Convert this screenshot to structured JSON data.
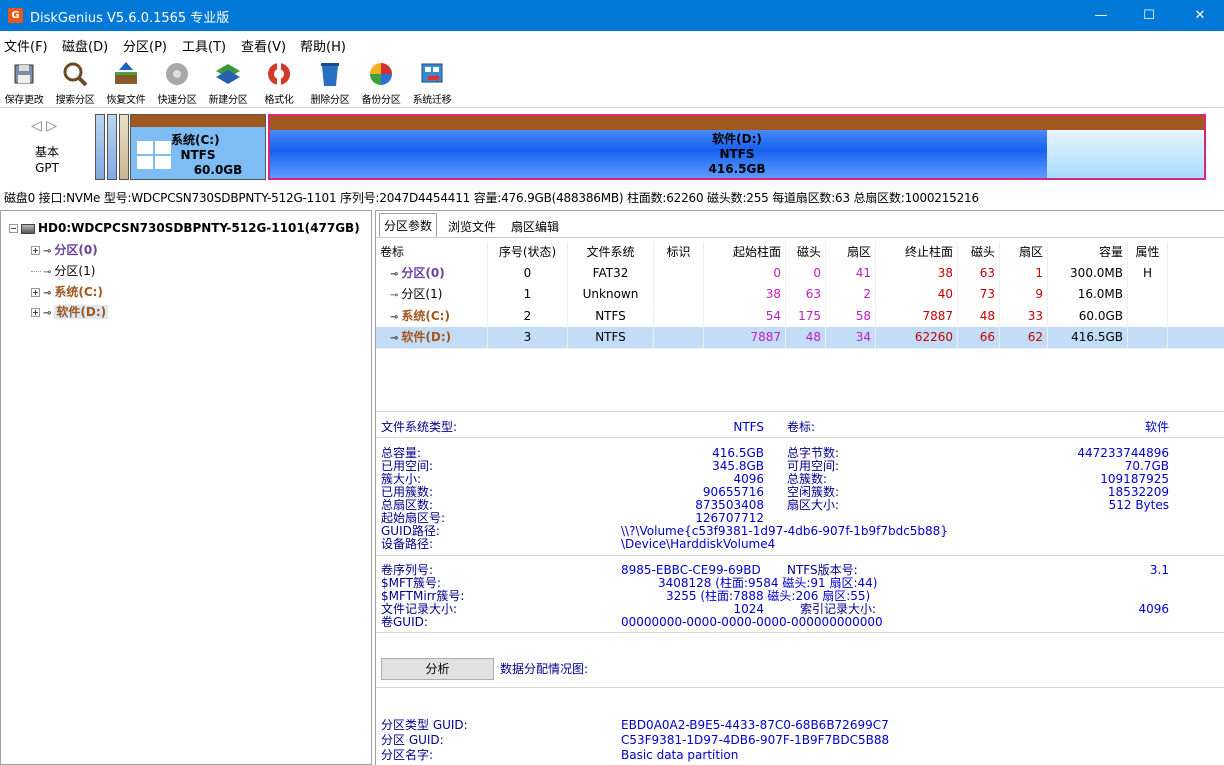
{
  "window": {
    "icon_letter": "G",
    "title": "DiskGenius V5.6.0.1565 专业版",
    "minimize": "—",
    "maximize": "☐",
    "close": "✕"
  },
  "menu": [
    "文件(F)",
    "磁盘(D)",
    "分区(P)",
    "工具(T)",
    "查看(V)",
    "帮助(H)"
  ],
  "toolbar": [
    {
      "label": "保存更改",
      "icon": "save-icon"
    },
    {
      "label": "搜索分区",
      "icon": "search-icon"
    },
    {
      "label": "恢复文件",
      "icon": "recover-icon"
    },
    {
      "label": "快速分区",
      "icon": "quick-partition-icon"
    },
    {
      "label": "新建分区",
      "icon": "new-partition-icon"
    },
    {
      "label": "格式化",
      "icon": "format-icon"
    },
    {
      "label": "删除分区",
      "icon": "delete-icon"
    },
    {
      "label": "备份分区",
      "icon": "backup-icon"
    },
    {
      "label": "系统迁移",
      "icon": "migrate-icon"
    }
  ],
  "diskmap": {
    "nav": "◁ ▷",
    "type_line1": "基本",
    "type_line2": "GPT",
    "c": {
      "name": "系统(C:)",
      "fs": "NTFS",
      "size": "60.0GB"
    },
    "d": {
      "name": "软件(D:)",
      "fs": "NTFS",
      "size": "416.5GB"
    }
  },
  "disk_info": "磁盘0 接口:NVMe  型号:WDCPCSN730SDBPNTY-512G-1101  序列号:2047D4454411  容量:476.9GB(488386MB)  柱面数:62260  磁头数:255  每道扇区数:63  总扇区数:1000215216",
  "tree": {
    "root": "HD0:WDCPCSN730SDBPNTY-512G-1101(477GB)",
    "items": [
      "分区(0)",
      "分区(1)",
      "系统(C:)",
      "软件(D:)"
    ]
  },
  "tabs": [
    "分区参数",
    "浏览文件",
    "扇区编辑"
  ],
  "table": {
    "headers": [
      "卷标",
      "序号(状态)",
      "文件系统",
      "标识",
      "起始柱面",
      "磁头",
      "扇区",
      "终止柱面",
      "磁头",
      "扇区",
      "容量",
      "属性"
    ],
    "rows": [
      [
        "分区(0)",
        "0",
        "FAT32",
        "",
        "0",
        "0",
        "41",
        "38",
        "63",
        "1",
        "300.0MB",
        "H"
      ],
      [
        "分区(1)",
        "1",
        "Unknown",
        "",
        "38",
        "63",
        "2",
        "40",
        "73",
        "9",
        "16.0MB",
        ""
      ],
      [
        "系统(C:)",
        "2",
        "NTFS",
        "",
        "54",
        "175",
        "58",
        "7887",
        "48",
        "33",
        "60.0GB",
        ""
      ],
      [
        "软件(D:)",
        "3",
        "NTFS",
        "",
        "7887",
        "48",
        "34",
        "62260",
        "66",
        "62",
        "416.5GB",
        ""
      ]
    ]
  },
  "details": {
    "fs_type_label": "文件系统类型:",
    "fs_type": "NTFS",
    "vol_label_label": "卷标:",
    "vol_label": "软件",
    "total_cap_label": "总容量:",
    "total_cap": "416.5GB",
    "total_bytes_label": "总字节数:",
    "total_bytes": "447233744896",
    "used_label": "已用空间:",
    "used": "345.8GB",
    "free_label": "可用空间:",
    "free": "70.7GB",
    "cluster_size_label": "簇大小:",
    "cluster_size": "4096",
    "total_clusters_label": "总簇数:",
    "total_clusters": "109187925",
    "used_clusters_label": "已用簇数:",
    "used_clusters": "90655716",
    "free_clusters_label": "空闲簇数:",
    "free_clusters": "18532209",
    "total_sectors_label": "总扇区数:",
    "total_sectors": "873503408",
    "sector_size_label": "扇区大小:",
    "sector_size": "512 Bytes",
    "start_sector_label": "起始扇区号:",
    "start_sector": "126707712",
    "guid_path_label": "GUID路径:",
    "guid_path": "\\\\?\\Volume{c53f9381-1d97-4db6-907f-1b9f7bdc5b88}",
    "device_path_label": "设备路径:",
    "device_path": "\\Device\\HarddiskVolume4",
    "serial_label": "卷序列号:",
    "serial": "8985-EBBC-CE99-69BD",
    "ntfs_ver_label": "NTFS版本号:",
    "ntfs_ver": "3.1",
    "mft_label": "$MFT簇号:",
    "mft": "3408128 (柱面:9584 磁头:91 扇区:44)",
    "mftmirr_label": "$MFTMirr簇号:",
    "mftmirr": "3255 (柱面:7888 磁头:206 扇区:55)",
    "record_size_label": "文件记录大小:",
    "record_size": "1024",
    "index_size_label": "索引记录大小:",
    "index_size": "4096",
    "vol_guid_label": "卷GUID:",
    "vol_guid": "00000000-0000-0000-0000-000000000000",
    "analyze_button": "分析",
    "alloc_label": "数据分配情况图:",
    "ptype_guid_label": "分区类型 GUID:",
    "ptype_guid": "EBD0A0A2-B9E5-4433-87C0-68B6B72699C7",
    "p_guid_label": "分区 GUID:",
    "p_guid": "C53F9381-1D97-4DB6-907F-1B9F7BDC5B88",
    "p_name_label": "分区名字:",
    "p_name": "Basic data partition"
  }
}
